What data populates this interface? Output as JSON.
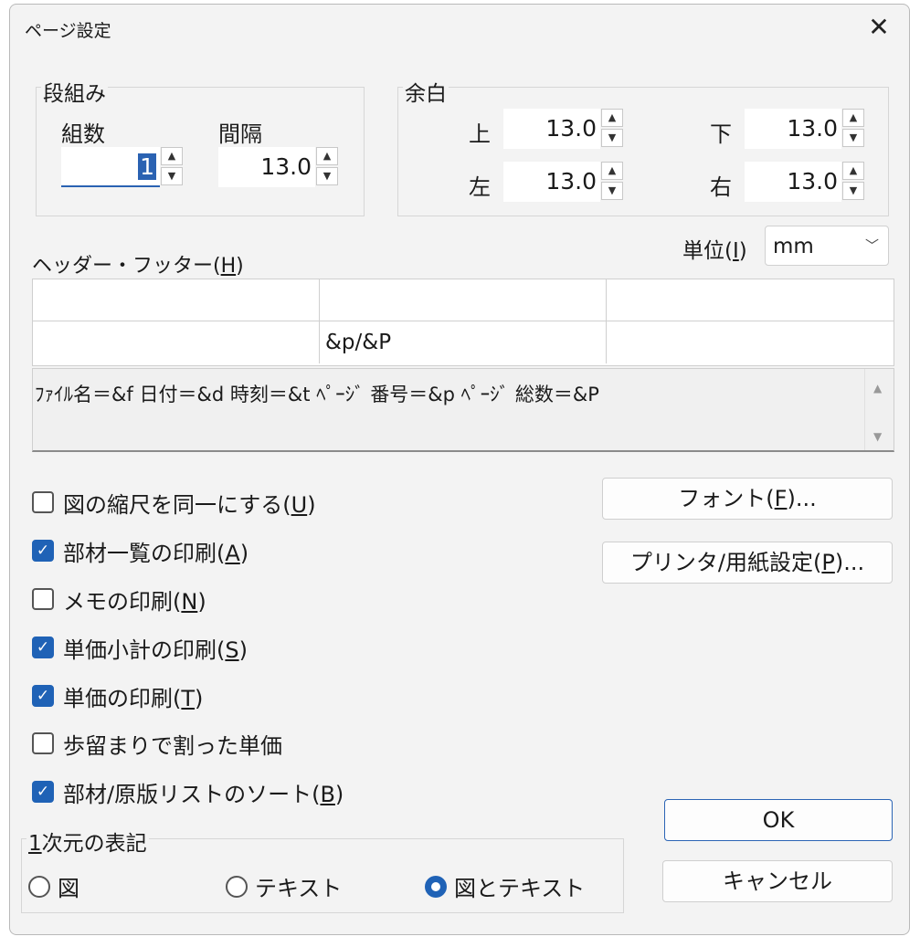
{
  "window": {
    "title": "ページ設定",
    "close_icon": "close-icon"
  },
  "columns": {
    "legend": "段組み",
    "count_label": "組数",
    "count_value": "1",
    "gap_label": "間隔",
    "gap_value": "13.0"
  },
  "margins": {
    "legend": "余白",
    "top_label": "上",
    "top_value": "13.0",
    "bottom_label": "下",
    "bottom_value": "13.0",
    "left_label": "左",
    "left_value": "13.0",
    "right_label": "右",
    "right_value": "13.0"
  },
  "unit": {
    "label": "単位(",
    "mnemonic": "I",
    "label_end": ")",
    "value": "mm"
  },
  "header_footer": {
    "label": "ヘッダー・フッター(",
    "mnemonic": "H",
    "label_end": ")",
    "rows": [
      [
        "",
        "",
        ""
      ],
      [
        "",
        "&p/&P",
        ""
      ]
    ],
    "hint": "ﾌｧｲﾙ名＝&f 日付＝&d 時刻＝&t ﾍﾟｰｼﾞ 番号＝&p ﾍﾟｰｼﾞ 総数＝&P"
  },
  "options": [
    {
      "text": "図の縮尺を同一にする(",
      "mnemonic": "U",
      "end": ")",
      "checked": false
    },
    {
      "text": "部材一覧の印刷(",
      "mnemonic": "A",
      "end": ")",
      "checked": true
    },
    {
      "text": "メモの印刷(",
      "mnemonic": "N",
      "end": ")",
      "checked": false
    },
    {
      "text": "単価小計の印刷(",
      "mnemonic": "S",
      "end": ")",
      "checked": true
    },
    {
      "text": "単価の印刷(",
      "mnemonic": "T",
      "end": ")",
      "checked": true
    },
    {
      "text": "歩留まりで割った単価",
      "mnemonic": "",
      "end": "",
      "checked": false
    },
    {
      "text": "部材/原版リストのソート(",
      "mnemonic": "B",
      "end": ")",
      "checked": true
    }
  ],
  "buttons": {
    "font": {
      "label": "フォント(",
      "mnemonic": "F",
      "end": ")..."
    },
    "printer": {
      "label": "プリンタ/用紙設定(",
      "mnemonic": "P",
      "end": ")..."
    },
    "ok": "OK",
    "cancel": "キャンセル"
  },
  "dimension": {
    "legend_mnemonic": "1",
    "legend_rest": "次元の表記",
    "choices": [
      "図",
      "テキスト",
      "図とテキスト"
    ],
    "selected_index": 2
  },
  "colors": {
    "accent": "#1f62b6",
    "background": "#f3f3f3"
  }
}
